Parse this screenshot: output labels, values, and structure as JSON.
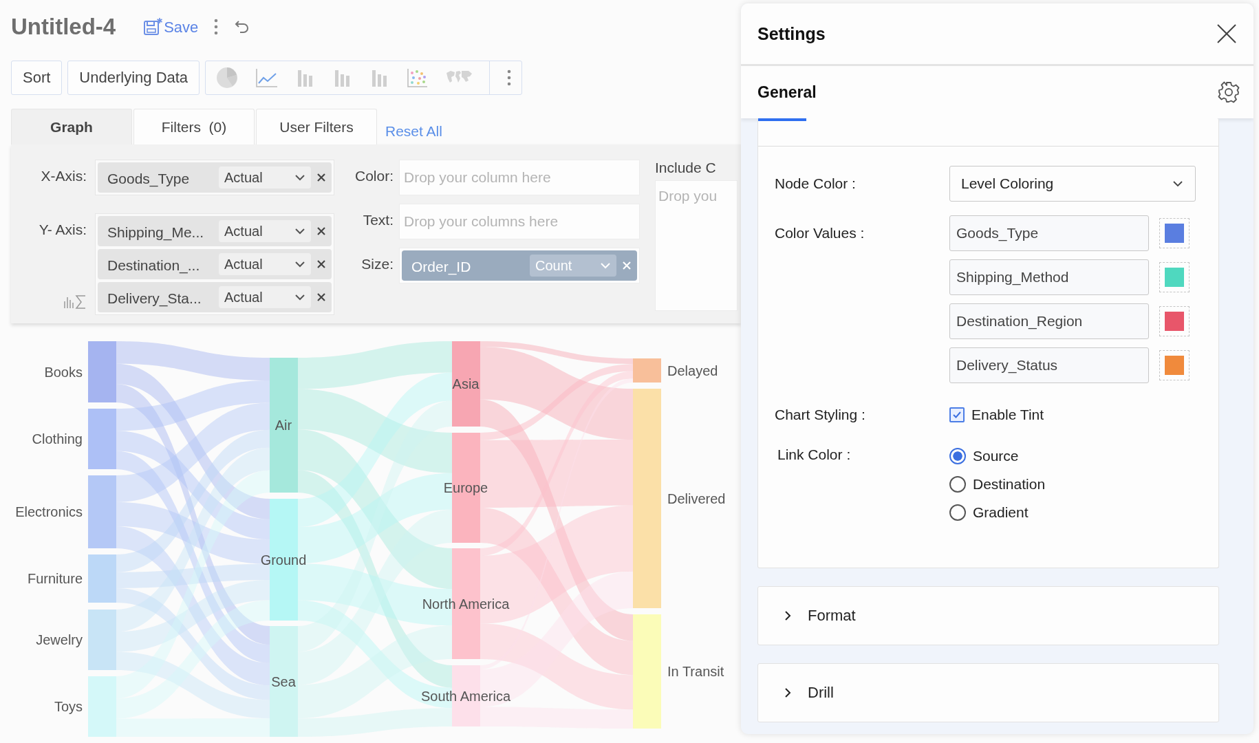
{
  "document": {
    "title": "Untitled-4",
    "save_label": "Save"
  },
  "toolbar": {
    "buttons": [
      "Sort",
      "Underlying Data"
    ]
  },
  "tabs": [
    {
      "label": "Graph",
      "selected": true
    },
    {
      "label": "Filters  (0)",
      "selected": false
    },
    {
      "label": "User Filters",
      "selected": false
    }
  ],
  "reset_link": "Reset All",
  "shelves": {
    "x_axis": {
      "label": "X-Axis:",
      "fields": [
        {
          "name": "Goods_Type",
          "aggregation": "Actual"
        }
      ]
    },
    "y_axis": {
      "label": "Y- Axis:",
      "fields": [
        {
          "name": "Shipping_Me...",
          "aggregation": "Actual"
        },
        {
          "name": "Destination_...",
          "aggregation": "Actual"
        },
        {
          "name": "Delivery_Sta...",
          "aggregation": "Actual"
        }
      ]
    },
    "color": {
      "label": "Color:",
      "placeholder": "Drop your column here"
    },
    "text": {
      "label": "Text:",
      "placeholder": "Drop your columns here"
    },
    "size": {
      "label": "Size:",
      "fields": [
        {
          "name": "Order_ID",
          "aggregation": "Count"
        }
      ]
    },
    "include": {
      "label": "Include C",
      "placeholder": "Drop you"
    }
  },
  "chart": {
    "columns": [
      {
        "nodes": [
          {
            "label": "Books",
            "color": "#a5b4f0"
          },
          {
            "label": "Clothing",
            "color": "#adc0f6"
          },
          {
            "label": "Electronics",
            "color": "#b4c8f6"
          },
          {
            "label": "Furniture",
            "color": "#bcd8f7"
          },
          {
            "label": "Jewelry",
            "color": "#c8e4f6"
          },
          {
            "label": "Toys",
            "color": "#d4f8f9"
          }
        ]
      },
      {
        "nodes": [
          {
            "label": "Air",
            "color": "#a5e8dc"
          },
          {
            "label": "Ground",
            "color": "#b5f7f5"
          },
          {
            "label": "Sea",
            "color": "#cff5f2"
          }
        ]
      },
      {
        "nodes": [
          {
            "label": "Asia",
            "color": "#f7a6b2"
          },
          {
            "label": "Europe",
            "color": "#fbb4be"
          },
          {
            "label": "North America",
            "color": "#fdc2cc"
          },
          {
            "label": "South America",
            "color": "#fde0ea"
          }
        ]
      },
      {
        "nodes": [
          {
            "label": "Delayed",
            "color": "#f8bf9a"
          },
          {
            "label": "Delivered",
            "color": "#fbe0a8"
          },
          {
            "label": "In Transit",
            "color": "#fbfcb8"
          }
        ]
      }
    ]
  },
  "settings": {
    "title": "Settings",
    "section": "General",
    "node_color": {
      "label": "Node Color :",
      "value": "Level Coloring"
    },
    "color_values": {
      "label": "Color Values :",
      "items": [
        {
          "name": "Goods_Type",
          "color": "#5a7ee0"
        },
        {
          "name": "Shipping_Method",
          "color": "#4fd8bf"
        },
        {
          "name": "Destination_Region",
          "color": "#e8566a"
        },
        {
          "name": "Delivery_Status",
          "color": "#f08a3c"
        }
      ]
    },
    "chart_styling": {
      "label": "Chart Styling :",
      "option": "Enable Tint",
      "checked": true
    },
    "link_color": {
      "label": "Link Color :",
      "options": [
        {
          "label": "Source",
          "selected": true
        },
        {
          "label": "Destination",
          "selected": false
        },
        {
          "label": "Gradient",
          "selected": false
        }
      ]
    },
    "panels": [
      {
        "label": "Format",
        "expanded": false
      },
      {
        "label": "Drill",
        "expanded": false
      }
    ]
  }
}
